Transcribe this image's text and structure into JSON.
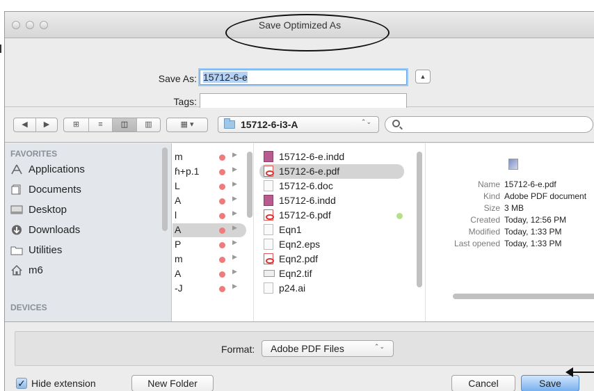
{
  "window": {
    "title": "Save Optimized As"
  },
  "save_as": {
    "label": "Save As:",
    "value": "15712-6-e"
  },
  "tags": {
    "label": "Tags:",
    "value": ""
  },
  "toolbar": {
    "back_glyph": "◀",
    "forward_glyph": "▶",
    "view_glyphs": [
      "⊞",
      "≡",
      "◫",
      "▥"
    ],
    "arrange_glyph": "▦ ▾",
    "collapse_glyph": "▲",
    "folder": "15712-6-i3-A",
    "updown_glyph": "⌃⌄",
    "search_placeholder": ""
  },
  "sidebar": {
    "favorites_header": "FAVORITES",
    "devices_header": "DEVICES",
    "items": [
      {
        "label": "Applications",
        "icon": "applications-icon"
      },
      {
        "label": "Documents",
        "icon": "documents-icon"
      },
      {
        "label": "Desktop",
        "icon": "desktop-icon"
      },
      {
        "label": "Downloads",
        "icon": "downloads-icon"
      },
      {
        "label": "Utilities",
        "icon": "folder-icon"
      },
      {
        "label": "m6",
        "icon": "home-icon"
      }
    ]
  },
  "column1": {
    "rows": [
      "m",
      "ɦ+p.1",
      "L",
      "A",
      "l",
      "A",
      "P",
      "m",
      "A",
      "-J"
    ],
    "selected_index": 5,
    "tag_color": "#f07b7b"
  },
  "column2": {
    "files": [
      {
        "name": "15712-6-e.indd",
        "type": "indd"
      },
      {
        "name": "15712-6-e.pdf",
        "type": "pdf"
      },
      {
        "name": "15712-6.doc",
        "type": "doc"
      },
      {
        "name": "15712-6.indd",
        "type": "indd"
      },
      {
        "name": "15712-6.pdf",
        "type": "pdf"
      },
      {
        "name": "Eqn1",
        "type": "doc"
      },
      {
        "name": "Eqn2.eps",
        "type": "doc"
      },
      {
        "name": "Eqn2.pdf",
        "type": "pdf"
      },
      {
        "name": "Eqn2.tif",
        "type": "tif"
      },
      {
        "name": "p24.ai",
        "type": "doc"
      }
    ],
    "selected_index": 1,
    "green_tag_index": 4
  },
  "preview": {
    "info": [
      {
        "key": "Name",
        "value": "15712-6-e.pdf"
      },
      {
        "key": "Kind",
        "value": "Adobe PDF document"
      },
      {
        "key": "Size",
        "value": "3 MB"
      },
      {
        "key": "Created",
        "value": "Today, 12:56 PM"
      },
      {
        "key": "Modified",
        "value": "Today, 1:33 PM"
      },
      {
        "key": "Last opened",
        "value": "Today, 1:33 PM"
      }
    ]
  },
  "format": {
    "label": "Format:",
    "value": "Adobe PDF Files"
  },
  "footer": {
    "hide_extension_label": "Hide extension",
    "hide_extension_checked": true,
    "check_glyph": "✓",
    "new_folder_label": "New Folder",
    "cancel_label": "Cancel",
    "save_label": "Save"
  },
  "colors": {
    "accent": "#6aa8e8",
    "selection": "#b3d2f5",
    "sidebar_bg": "#e3e7ec",
    "red_tag": "#f07b7b",
    "green_tag": "#b5e08a"
  }
}
